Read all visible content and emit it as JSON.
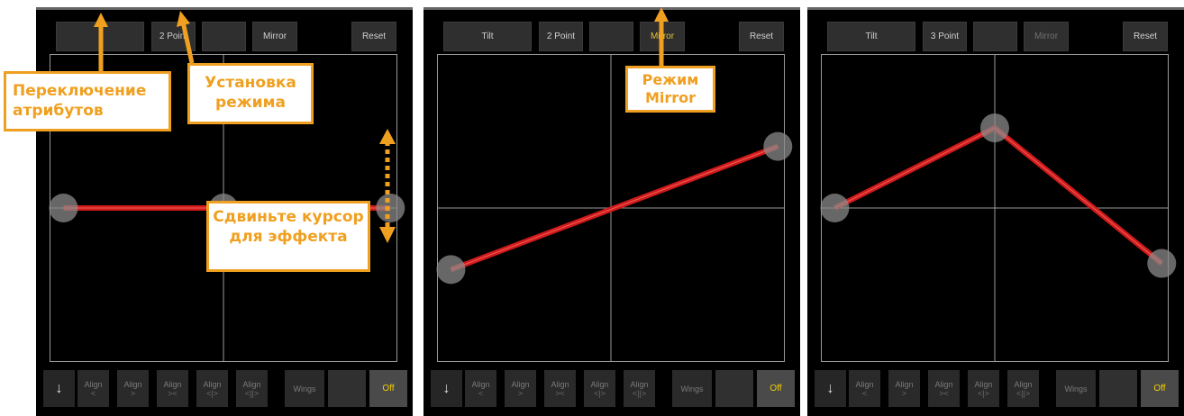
{
  "panels": [
    {
      "toolbar": {
        "b1": "",
        "b2": "2 Point",
        "b3": "",
        "b4": "Mirror",
        "b5": "Reset"
      },
      "grid": {
        "points": [
          [
            0.04,
            0.5
          ],
          [
            0.5,
            0.5
          ],
          [
            0.98,
            0.5
          ]
        ]
      }
    },
    {
      "toolbar": {
        "b1": "Tilt",
        "b2": "2 Point",
        "b3": "",
        "b4": "Mirror",
        "b5": "Reset"
      },
      "grid": {
        "points": [
          [
            0.04,
            0.7
          ],
          [
            0.98,
            0.3
          ]
        ]
      }
    },
    {
      "toolbar": {
        "b1": "Tilt",
        "b2": "3 Point",
        "b3": "",
        "b4": "Mirror",
        "b5": "Reset"
      },
      "grid": {
        "points": [
          [
            0.04,
            0.5
          ],
          [
            0.5,
            0.24
          ],
          [
            0.98,
            0.68
          ]
        ]
      }
    }
  ],
  "bottom_bar": {
    "arrow": "↓",
    "align_label": "Align",
    "align_subs": [
      "<",
      ">",
      "><",
      "<|>",
      "<||>"
    ],
    "wings": "Wings",
    "off": "Off"
  },
  "callouts": {
    "attributes": "Переключение атрибутов",
    "mode": "Установка режима",
    "move_cursor": "Сдвиньте курсор для эффекта",
    "mirror": "Режим Mirror"
  },
  "colors": {
    "accent": "#f0a020",
    "line": "#d11a1a",
    "handle": "#8a8a8a",
    "off_text": "#f3d000",
    "mirror_active": "#e2c23a"
  }
}
